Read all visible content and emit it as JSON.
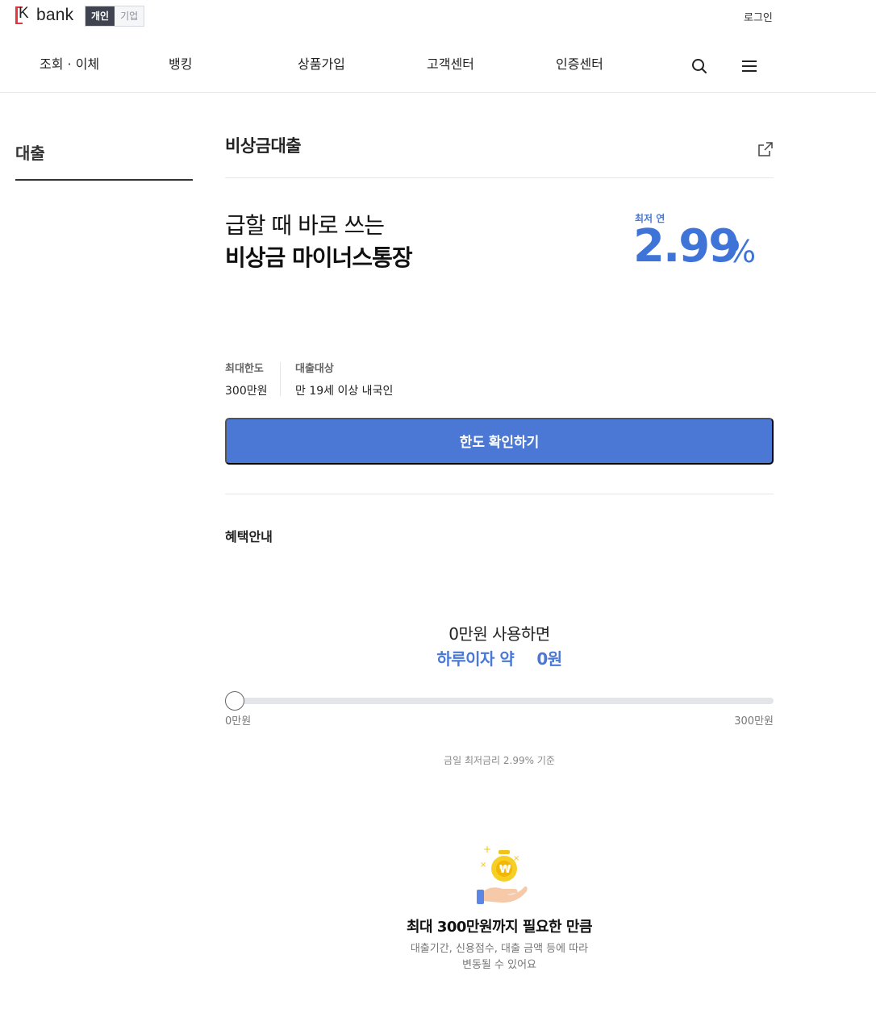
{
  "header": {
    "logo_text": "bank",
    "segments": [
      "개인",
      "기업"
    ],
    "login": "로그인",
    "nav": [
      "조회 · 이체",
      "뱅킹",
      "상품가입",
      "고객센터",
      "인증센터"
    ],
    "icons": [
      "search-icon",
      "hamburger-menu-icon"
    ]
  },
  "sidebar": {
    "title": "대출"
  },
  "page": {
    "title": "비상금대출",
    "share_icon": "share-icon",
    "headline_line1": "급할 때 바로 쓰는",
    "headline_line2": "비상금 마이너스통장",
    "rate_label": "최저 연",
    "rate_value": "2.99",
    "rate_unit": "%",
    "info": [
      {
        "label": "최대한도",
        "value": "300만원"
      },
      {
        "label": "대출대상",
        "value": "만 19세 이상 내국인"
      }
    ],
    "cta_label": "한도 확인하기"
  },
  "benefits": {
    "title": "혜택안내",
    "calc_line1": "0만원 사용하면",
    "calc_interest_label": "하루이자 약",
    "calc_interest_value": "0원",
    "slider": {
      "min_label": "0만원",
      "max_label": "300만원",
      "value": 0
    },
    "note": "금일 최저금리 2.99% 기준",
    "illustration": "money-bag-hand-icon",
    "heading": "최대 300만원까지 필요한 만큼",
    "desc_line1": "대출기간, 신용점수, 대출 금액 등에 따라",
    "desc_line2": "변동될 수 있어요"
  },
  "colors": {
    "brand_red": "#e8343f",
    "accent_blue": "#4a78d4"
  }
}
